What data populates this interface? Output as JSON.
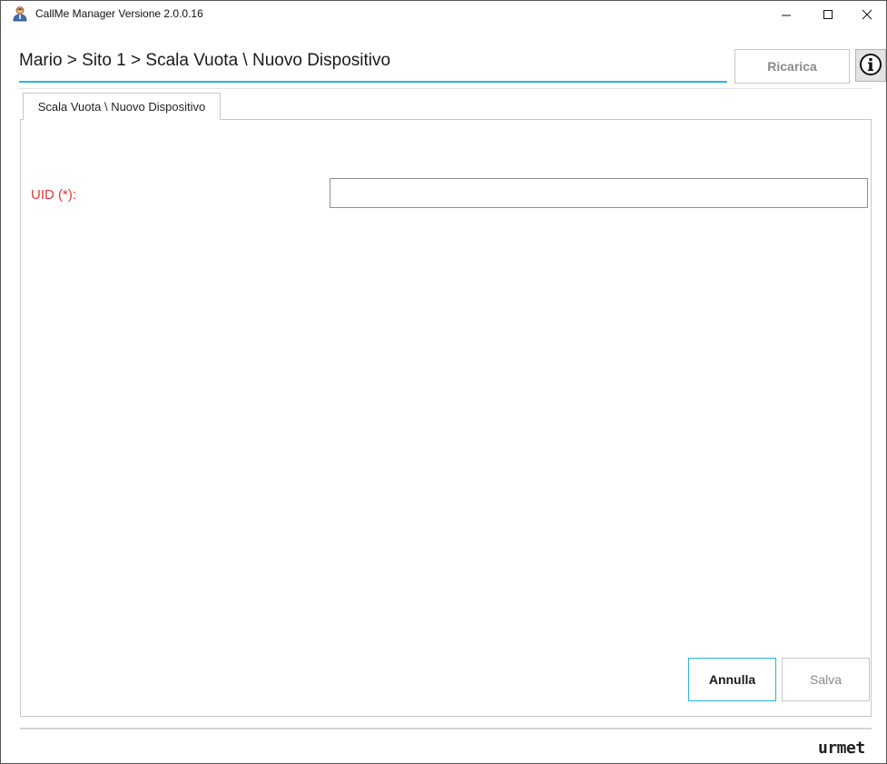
{
  "window": {
    "title": "CallMe Manager Versione 2.0.0.16",
    "app_icon": "user-icon",
    "controls": {
      "minimize_icon": "minimize-icon",
      "maximize_icon": "maximize-icon",
      "close_icon": "close-icon"
    }
  },
  "header": {
    "breadcrumb": "Mario > Sito 1 > Scala Vuota \\ Nuovo Dispositivo",
    "reload_label": "Ricarica",
    "info_icon": "info-icon"
  },
  "tabs": [
    {
      "label": "Scala Vuota \\ Nuovo Dispositivo",
      "active": true
    }
  ],
  "form": {
    "uid_label": "UID (*):",
    "uid_value": "",
    "uid_placeholder": ""
  },
  "actions": {
    "cancel_label": "Annulla",
    "save_label": "Salva"
  },
  "footer": {
    "brand": "urmet"
  },
  "colors": {
    "accent": "#27b5d8",
    "required_label": "#e23a3a",
    "disabled_text": "#8a8a8a"
  }
}
